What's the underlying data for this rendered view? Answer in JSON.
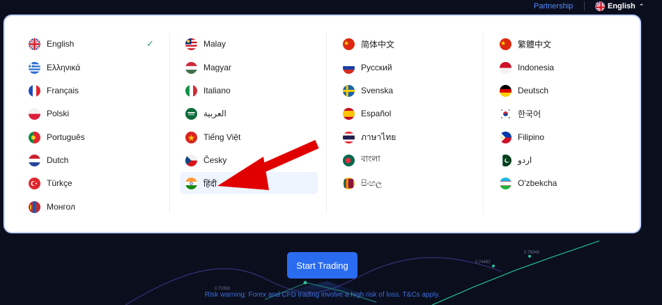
{
  "topbar": {
    "partnership_label": "Partnership",
    "current_language": "English"
  },
  "languages": [
    [
      {
        "label": "English",
        "flag": "gb-flag",
        "selected": true
      },
      {
        "label": "Ελληνικά",
        "flag": "gr-flag"
      },
      {
        "label": "Français",
        "flag": "fr-flag"
      },
      {
        "label": "Polski",
        "flag": "pl-flag"
      },
      {
        "label": "Português",
        "flag": "pt-flag"
      },
      {
        "label": "Dutch",
        "flag": "nl-flag"
      },
      {
        "label": "Türkçe",
        "flag": "tr-flag"
      },
      {
        "label": "Монгол",
        "flag": "mn-flag"
      }
    ],
    [
      {
        "label": "Malay",
        "flag": "my-flag"
      },
      {
        "label": "Magyar",
        "flag": "hu-flag"
      },
      {
        "label": "Italiano",
        "flag": "it-flag"
      },
      {
        "label": "العربية",
        "flag": "sa-flag"
      },
      {
        "label": "Tiếng Việt",
        "flag": "vn-flag"
      },
      {
        "label": "Česky",
        "flag": "cz-flag"
      },
      {
        "label": "हिंदी",
        "flag": "in-flag",
        "highlighted": true
      }
    ],
    [
      {
        "label": "简体中文",
        "flag": "cn-flag"
      },
      {
        "label": "Русский",
        "flag": "ru-flag"
      },
      {
        "label": "Svenska",
        "flag": "se-flag"
      },
      {
        "label": "Español",
        "flag": "es-flag"
      },
      {
        "label": "ภาษาไทย",
        "flag": "th-flag"
      },
      {
        "label": "বাংলা",
        "flag": "bd-flag"
      },
      {
        "label": "සිංහල",
        "flag": "lk-flag"
      }
    ],
    [
      {
        "label": "繁體中文",
        "flag": "cn-flag"
      },
      {
        "label": "Indonesia",
        "flag": "id-flag"
      },
      {
        "label": "Deutsch",
        "flag": "de-flag"
      },
      {
        "label": "한국어",
        "flag": "kr-flag"
      },
      {
        "label": "Filipino",
        "flag": "ph-flag"
      },
      {
        "label": "اردو",
        "flag": "pk-flag"
      },
      {
        "label": "O'zbekcha",
        "flag": "uz-flag"
      }
    ]
  ],
  "check_glyph": "✓",
  "cta": {
    "start_trading_label": "Start Trading"
  },
  "risk_warning": "Risk warning: Forex and CFD trading involve a high risk of loss. T&Cs apply.",
  "background_ticks": [
    "0.70358",
    "0.74492",
    "0.78349"
  ],
  "colors": {
    "accent": "#2a6cf0",
    "link": "#4f8cff",
    "check": "#2ea36b",
    "highlight": "#eef5ff",
    "annotation_arrow": "#e00000"
  }
}
